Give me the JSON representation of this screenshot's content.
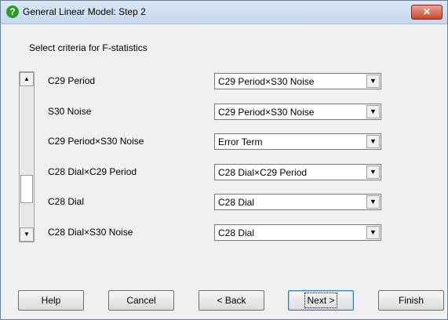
{
  "window": {
    "title": "General Linear Model: Step 2",
    "close_label": "✕"
  },
  "instruction": "Select criteria for F-statistics",
  "scrollbar": {
    "up_arrow": "▲",
    "down_arrow": "▼",
    "position_fraction": 0.78,
    "visible_fraction": 0.2
  },
  "rows": [
    {
      "label": "C29 Period",
      "value": "C29 Period×S30 Noise"
    },
    {
      "label": "S30 Noise",
      "value": "C29 Period×S30 Noise"
    },
    {
      "label": "C29 Period×S30 Noise",
      "value": "Error Term"
    },
    {
      "label": "C28 Dial×C29 Period",
      "value": "C28 Dial×C29 Period"
    },
    {
      "label": "C28 Dial",
      "value": "C28 Dial"
    },
    {
      "label": "C28 Dial×S30 Noise",
      "value": "C28 Dial"
    }
  ],
  "combo_arrow": "▼",
  "buttons": {
    "help": "Help",
    "cancel": "Cancel",
    "back": "< Back",
    "next": "Next >",
    "finish": "Finish"
  }
}
